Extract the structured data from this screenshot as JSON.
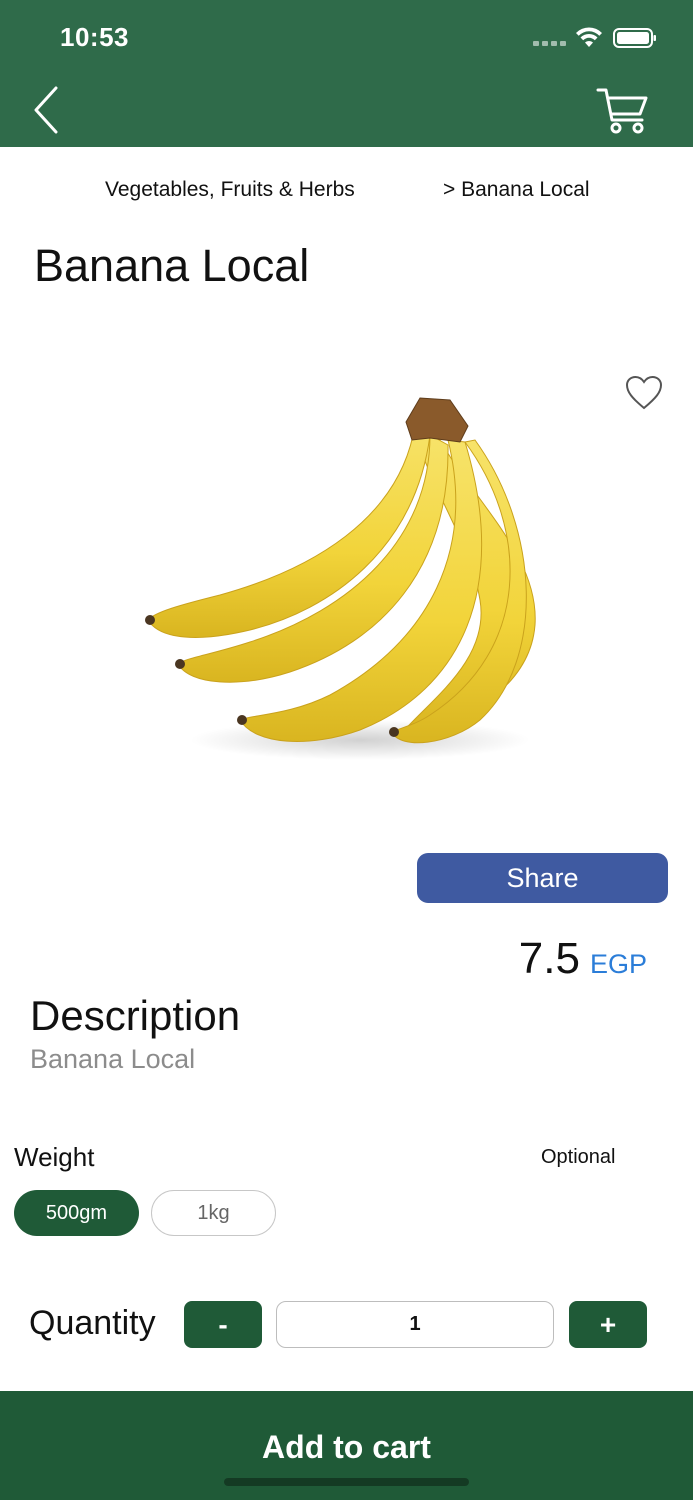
{
  "status_bar": {
    "time": "10:53"
  },
  "breadcrumb": {
    "category": "Vegetables, Fruits & Herbs",
    "current": "> Banana Local"
  },
  "product": {
    "title": "Banana Local",
    "image_icon": "banana-bunch-image",
    "favorite_icon": "heart-outline-icon"
  },
  "share": {
    "label": "Share"
  },
  "price": {
    "value": "7.5",
    "currency": "EGP"
  },
  "description": {
    "heading": "Description",
    "text": "Banana Local"
  },
  "weight": {
    "label": "Weight",
    "optional_label": "Optional",
    "options": [
      {
        "label": "500gm",
        "selected": true
      },
      {
        "label": "1kg",
        "selected": false
      }
    ]
  },
  "quantity": {
    "label": "Quantity",
    "minus": "-",
    "plus": "+",
    "value": "1"
  },
  "cart_button": {
    "label": "Add to cart"
  },
  "colors": {
    "header": "#2f6b4a",
    "primary": "#1f5a37",
    "share": "#3f5aa1",
    "currency": "#2b7dd8"
  }
}
